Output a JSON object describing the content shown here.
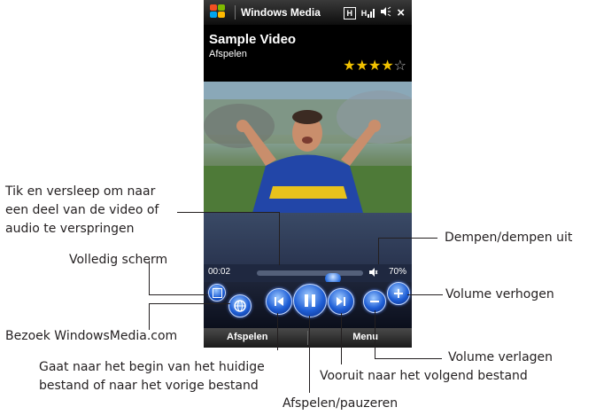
{
  "device": {
    "app_title": "Windows Media",
    "status": {
      "network": "H",
      "signal": "H",
      "sound": "speaker",
      "close": "×"
    },
    "now_playing": {
      "title": "Sample Video",
      "status": "Afspelen",
      "rating": 4,
      "rating_max": 5
    },
    "seek": {
      "elapsed": "00:02",
      "position_fraction": 0.14
    },
    "volume": {
      "label": "70%",
      "level": 0.7
    },
    "softkeys": {
      "left": "Afspelen",
      "right": "Menu"
    },
    "icons": [
      "windows-logo-icon",
      "network-icon",
      "signal-icon",
      "speaker-icon",
      "close-icon",
      "star-icon",
      "mute-icon",
      "fullscreen-icon",
      "globe-icon",
      "previous-icon",
      "pause-icon",
      "next-icon",
      "volume-down-icon",
      "volume-up-icon"
    ]
  },
  "callouts": {
    "seek": [
      "Tik en versleep om naar",
      "een deel van de video of",
      "audio te verspringen"
    ],
    "fullscreen": "Volledig scherm",
    "website": "Bezoek WindowsMedia.com",
    "previous": [
      "Gaat naar het begin van het huidige",
      "bestand of naar het vorige bestand"
    ],
    "play_pause": "Afspelen/pauzeren",
    "next": "Vooruit naar het volgend bestand",
    "volume_down": "Volume verlagen",
    "volume_up": "Volume verhogen",
    "mute": "Dempen/dempen uit"
  },
  "colors": {
    "accent": "#1f5fd6",
    "star": "#f2c200",
    "text": "#231f20"
  }
}
